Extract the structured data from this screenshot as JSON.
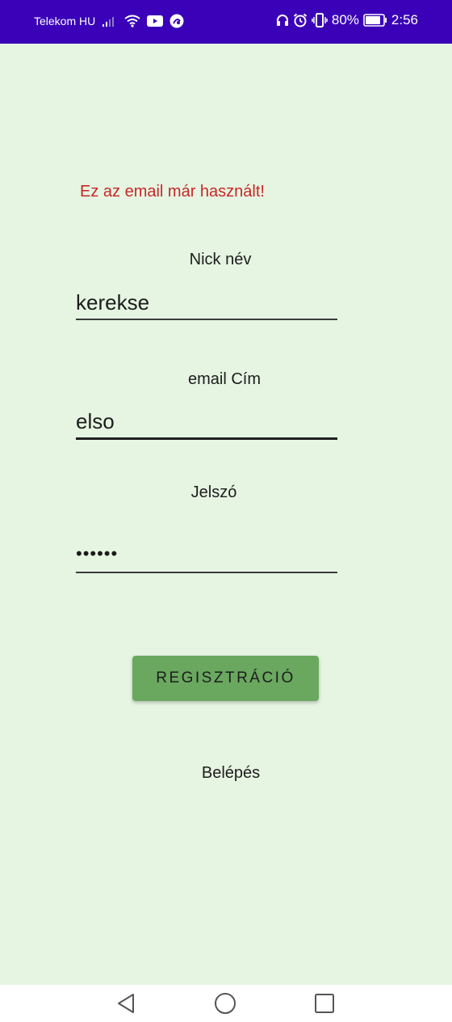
{
  "status_bar": {
    "carrier": "Telekom HU",
    "battery_percent": "80%",
    "time": "2:56",
    "icons_left": [
      "signal-icon",
      "wifi-icon",
      "youtube-icon",
      "app-notification-icon"
    ],
    "icons_right": [
      "headphones-icon",
      "alarm-icon",
      "vibrate-icon",
      "battery-icon"
    ]
  },
  "form": {
    "error_message": "Ez az email már használt!",
    "nick": {
      "label": "Nick név",
      "value": "kerekse"
    },
    "email": {
      "label": "email Cím",
      "value": "elso"
    },
    "password": {
      "label": "Jelszó",
      "value": "••••••"
    },
    "register_label": "REGISZTRÁCIÓ",
    "login_label": "Belépés"
  },
  "colors": {
    "status_bar": "#3a01b8",
    "background": "#e6f5e2",
    "error": "#c62828",
    "button": "#6aa860"
  },
  "nav_bar": {
    "icons": [
      "back-icon",
      "home-icon",
      "recents-icon"
    ]
  }
}
